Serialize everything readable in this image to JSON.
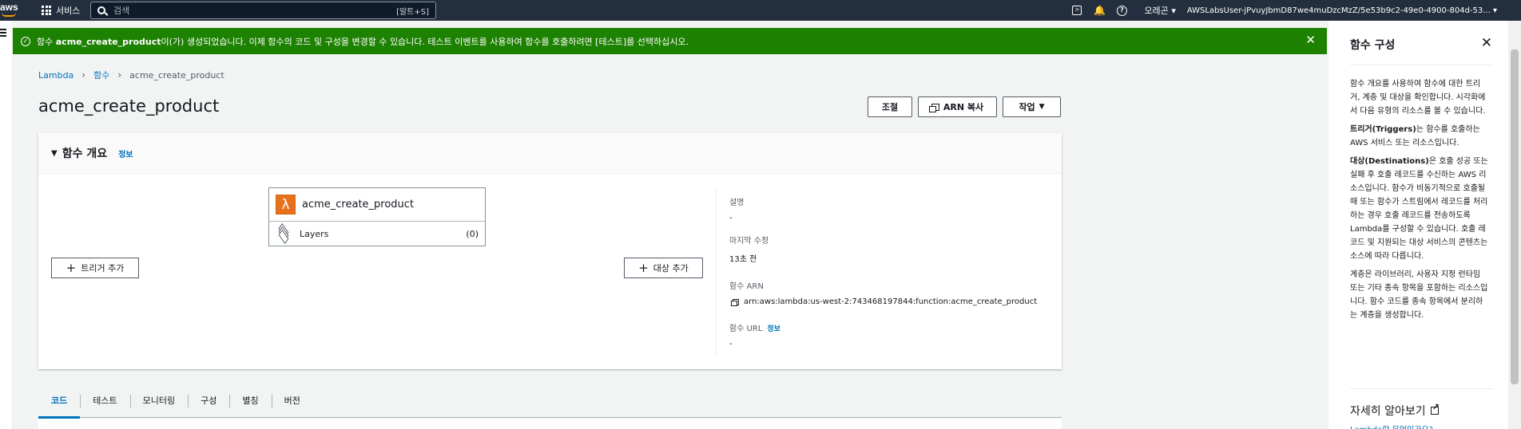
{
  "topnav": {
    "logo": "aws",
    "services_label": "서비스",
    "search_placeholder": "검색",
    "search_shortcut": "[알트+S]",
    "region": "오레곤",
    "user": "AWSLabsUser-jPvuyJbmD87we4muDzcMzZ/5e53b9c2-49e0-4900-804d-53..."
  },
  "flash": {
    "pre": "함수 ",
    "fn": "acme_create_product",
    "post": "이(가) 생성되었습니다. 이제 함수의 코드 및 구성을 변경할 수 있습니다. 테스트 이벤트를 사용하여 함수를 호출하려면 [테스트]를 선택하십시오.",
    "close": "✕"
  },
  "breadcrumb": {
    "root": "Lambda",
    "mid": "함수",
    "current": "acme_create_product"
  },
  "page": {
    "title": "acme_create_product",
    "throttle": "조절",
    "copy_arn": "ARN 복사",
    "actions": "작업"
  },
  "overview": {
    "header": "함수 개요",
    "info": "정보",
    "function_name": "acme_create_product",
    "layers_label": "Layers",
    "layers_count": "(0)",
    "add_trigger": "트리거 추가",
    "add_destination": "대상 추가",
    "description_label": "설명",
    "description_value": "-",
    "last_modified_label": "마지막 수정",
    "last_modified_value": "13초 전",
    "arn_label": "함수 ARN",
    "arn_value": "arn:aws:lambda:us-west-2:743468197844:function:acme_create_product",
    "url_label": "함수 URL",
    "url_info": "정보",
    "url_value": "-"
  },
  "tabs": [
    {
      "label": "코드",
      "active": true
    },
    {
      "label": "테스트"
    },
    {
      "label": "모니터링"
    },
    {
      "label": "구성"
    },
    {
      "label": "별칭"
    },
    {
      "label": "버전"
    }
  ],
  "help": {
    "title": "함수 구성",
    "close": "✕",
    "p1": "함수 개요를 사용하여 함수에 대한 트리거, 계층 및 대상을 확인합니다. 시각화에서 다음 유형의 리소스를 볼 수 있습니다.",
    "p2_b": "트리거(Triggers)",
    "p2": "는 함수를 호출하는 AWS 서비스 또는 리소스입니다.",
    "p3_b": "대상(Destinations)",
    "p3": "은 호출 성공 또는 실패 후 호출 레코드를 수신하는 AWS 리소스입니다. 함수가 비동기적으로 호출될 때 또는 함수가 스트림에서 레코드를 처리하는 경우 호출 레코드를 전송하도록 Lambda를 구성할 수 있습니다. 호출 레코드 및 지원되는 대상 서비스의 콘텐츠는 소스에 따라 다릅니다.",
    "p4": "계층은 라이브러리, 사용자 지정 런타임 또는 기타 종속 항목을 포함하는 리소스입니다. 함수 코드를 종속 항목에서 분리하는 계층을 생성합니다.",
    "learn_more": "자세히 알아보기",
    "learn_link": "Lambda란 무엇인가요?"
  },
  "colors": {
    "nav": "#232f3e",
    "flash": "#1d8102",
    "link": "#0073bb",
    "lambda": "#e7701c",
    "brand": "#ff9900"
  }
}
